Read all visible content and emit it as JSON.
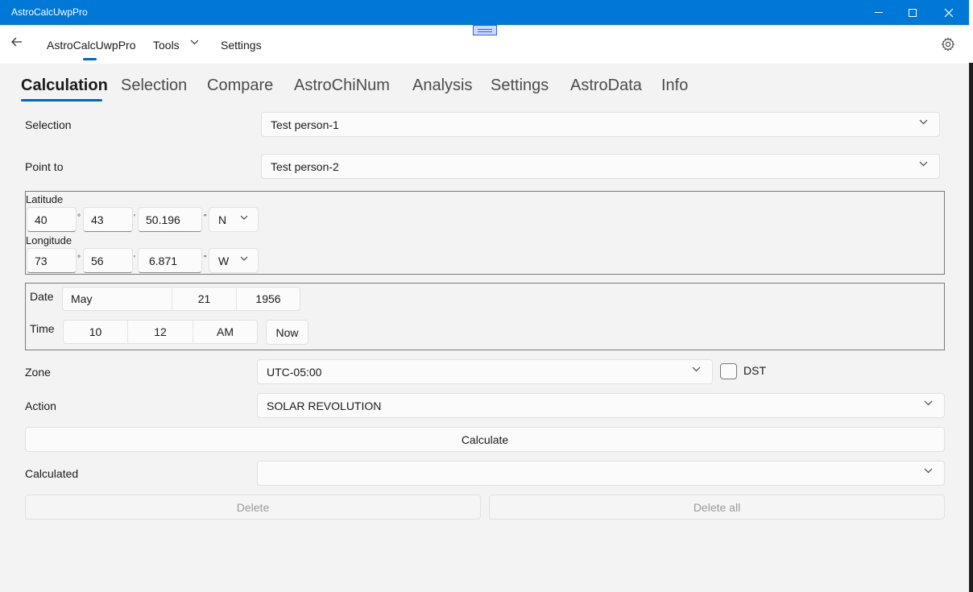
{
  "window": {
    "title": "AstroCalcUwpPro"
  },
  "nav": {
    "home": "AstroCalcUwpPro",
    "tools": "Tools",
    "settings": "Settings"
  },
  "tabs": [
    "Calculation",
    "Selection",
    "Compare",
    "AstroChiNum",
    "Analysis",
    "Settings",
    "AstroData",
    "Info"
  ],
  "form": {
    "selection_label": "Selection",
    "selection_value": "Test person-1",
    "point_to_label": "Point to",
    "point_to_value": "Test person-2",
    "latitude_label": "Latitude",
    "latitude": {
      "deg": "40",
      "min": "43",
      "sec": "50.196",
      "hemi": "N"
    },
    "longitude_label": "Longitude",
    "longitude": {
      "deg": "73",
      "min": "56",
      "sec": "6.871",
      "hemi": "W"
    },
    "units": {
      "deg": "°",
      "min": "'",
      "sec": "\""
    },
    "date_label": "Date",
    "date": {
      "month": "May",
      "day": "21",
      "year": "1956"
    },
    "time_label": "Time",
    "time": {
      "hour": "10",
      "minute": "12",
      "ampm": "AM"
    },
    "now_button": "Now",
    "zone_label": "Zone",
    "zone_value": "UTC-05:00",
    "dst_label": "DST",
    "dst_checked": false,
    "action_label": "Action",
    "action_value": "SOLAR REVOLUTION",
    "calculate_button": "Calculate",
    "calculated_label": "Calculated",
    "calculated_value": "",
    "delete_button": "Delete",
    "delete_all_button": "Delete all"
  },
  "icons": {
    "back": "back-arrow-icon",
    "gear": "gear-icon",
    "chevron": "chevron-down-icon",
    "minimize": "minimize-icon",
    "maximize": "maximize-icon",
    "close": "close-icon"
  },
  "colors": {
    "titlebar": "#0078d7",
    "accent": "#0067c0",
    "background": "#f3f3f3"
  }
}
